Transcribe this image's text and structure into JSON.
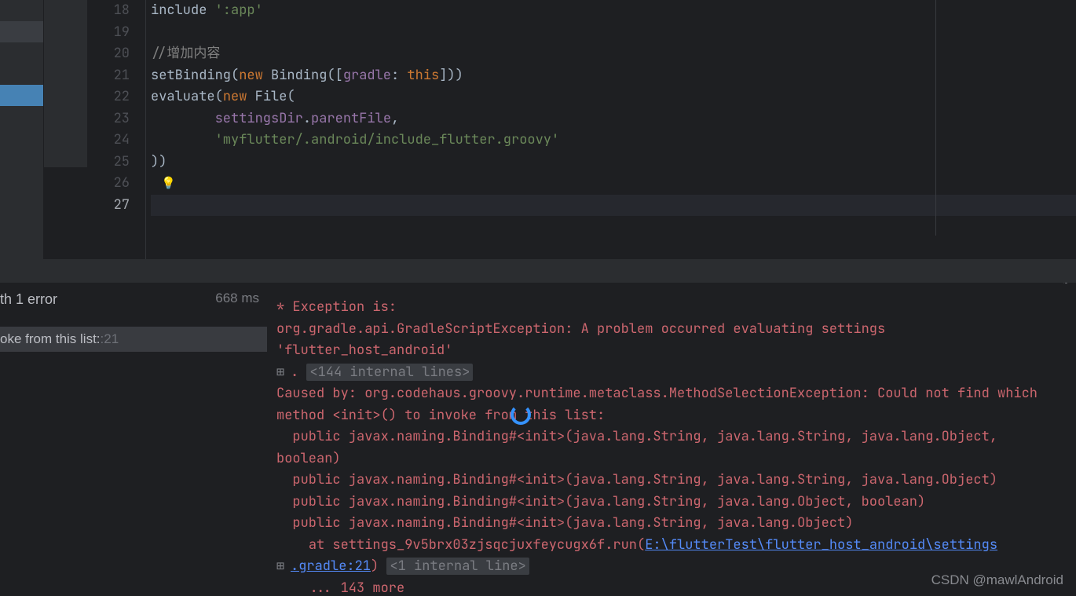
{
  "editor": {
    "lines": [
      {
        "n": 18,
        "tokens": [
          {
            "t": "include ",
            "c": "plain"
          },
          {
            "t": "':app'",
            "c": "str"
          }
        ]
      },
      {
        "n": 19,
        "tokens": []
      },
      {
        "n": 20,
        "tokens": [
          {
            "t": "//增加内容",
            "c": "comment"
          }
        ]
      },
      {
        "n": 21,
        "tokens": [
          {
            "t": "setBinding(",
            "c": "plain"
          },
          {
            "t": "new",
            "c": "kw"
          },
          {
            "t": " Binding([",
            "c": "plain"
          },
          {
            "t": "gradle",
            "c": "ident"
          },
          {
            "t": ": ",
            "c": "plain"
          },
          {
            "t": "this",
            "c": "kw"
          },
          {
            "t": "]))",
            "c": "plain"
          }
        ]
      },
      {
        "n": 22,
        "tokens": [
          {
            "t": "evaluate(",
            "c": "plain"
          },
          {
            "t": "new",
            "c": "kw"
          },
          {
            "t": " File(",
            "c": "plain"
          }
        ]
      },
      {
        "n": 23,
        "tokens": [
          {
            "t": "        ",
            "c": "plain"
          },
          {
            "t": "settingsDir",
            "c": "ident"
          },
          {
            "t": ".",
            "c": "plain"
          },
          {
            "t": "parentFile",
            "c": "ident"
          },
          {
            "t": ",",
            "c": "plain"
          }
        ]
      },
      {
        "n": 24,
        "tokens": [
          {
            "t": "        ",
            "c": "plain"
          },
          {
            "t": "'myflutter/.android/include_flutter.groovy'",
            "c": "str"
          }
        ]
      },
      {
        "n": 25,
        "tokens": [
          {
            "t": "))",
            "c": "plain"
          }
        ]
      },
      {
        "n": 26,
        "tokens": [],
        "bulb": true
      },
      {
        "n": 27,
        "tokens": [],
        "current": true,
        "cursor": true
      }
    ]
  },
  "build": {
    "status_text": "th 1 error",
    "time": "668 ms",
    "error_item": "oke from this list: ",
    "error_loc": ":21"
  },
  "console": {
    "l1": "* Exception is:",
    "l2": "org.gradle.api.GradleScriptException: A problem occurred evaluating settings 'flutter_host_android'",
    "l3_prefix": ". ",
    "l3_fold": "<144 internal lines>",
    "l4": "Caused by: org.codehaus.groovy.runtime.metaclass.MethodSelectionException: Could not find which method <init>() to invoke from this list:",
    "l5": "  public javax.naming.Binding#<init>(java.lang.String, java.lang.String, java.lang.Object, boolean)",
    "l6": "  public javax.naming.Binding#<init>(java.lang.String, java.lang.String, java.lang.Object)",
    "l7": "  public javax.naming.Binding#<init>(java.lang.String, java.lang.Object, boolean)",
    "l8": "  public javax.naming.Binding#<init>(java.lang.String, java.lang.Object)",
    "l9_prefix": "    at settings_9v5brx03zjsqcjuxfeycugx6f.run(",
    "l9_link": "E:\\flutterTest\\flutter_host_android\\settings",
    "l10_link": ".gradle:21",
    "l10_paren": ") ",
    "l10_fold": "<1 internal line>",
    "l11": "    ... 143 more"
  },
  "watermark": "CSDN @mawlAndroid",
  "icons": {
    "bulb": "💡",
    "gear": "⚙",
    "expand": "⊞"
  }
}
